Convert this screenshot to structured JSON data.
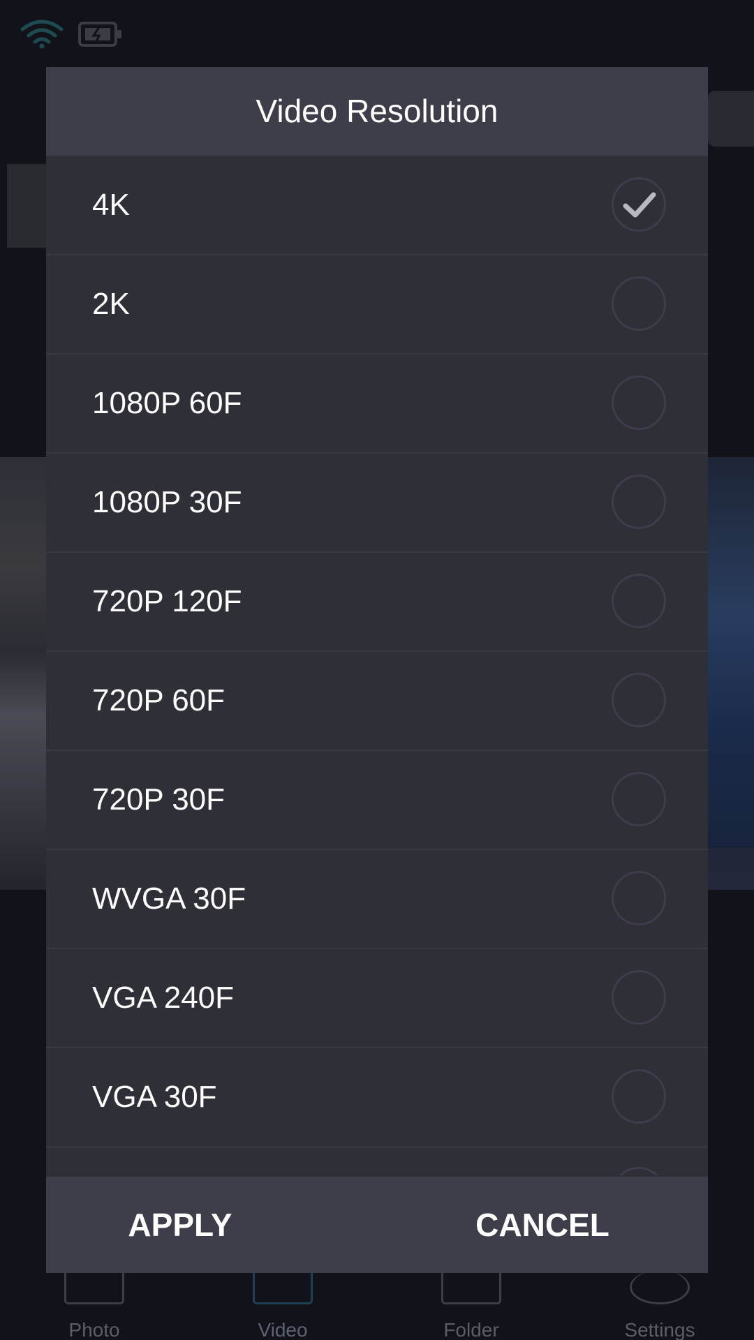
{
  "dialog": {
    "title": "Video Resolution",
    "options": [
      {
        "label": "4K",
        "selected": true
      },
      {
        "label": "2K",
        "selected": false
      },
      {
        "label": "1080P 60F",
        "selected": false
      },
      {
        "label": "1080P 30F",
        "selected": false
      },
      {
        "label": "720P 120F",
        "selected": false
      },
      {
        "label": "720P 60F",
        "selected": false
      },
      {
        "label": "720P 30F",
        "selected": false
      },
      {
        "label": "WVGA 30F",
        "selected": false
      },
      {
        "label": "VGA 240F",
        "selected": false
      },
      {
        "label": "VGA 30F",
        "selected": false
      }
    ],
    "apply_label": "APPLY",
    "cancel_label": "CANCEL"
  },
  "bottom_nav": {
    "items": [
      {
        "label": "Photo"
      },
      {
        "label": "Video"
      },
      {
        "label": "Folder"
      },
      {
        "label": "Settings"
      }
    ]
  },
  "status_bar": {
    "icons": [
      "wifi-icon",
      "battery-icon"
    ]
  },
  "colors": {
    "dialog_bg": "#2f2f38",
    "dialog_header_bg": "#3e3d4a",
    "text": "#ffffff",
    "radio_border": "#3f3d4b",
    "checkmark": "#b9b9c0"
  }
}
